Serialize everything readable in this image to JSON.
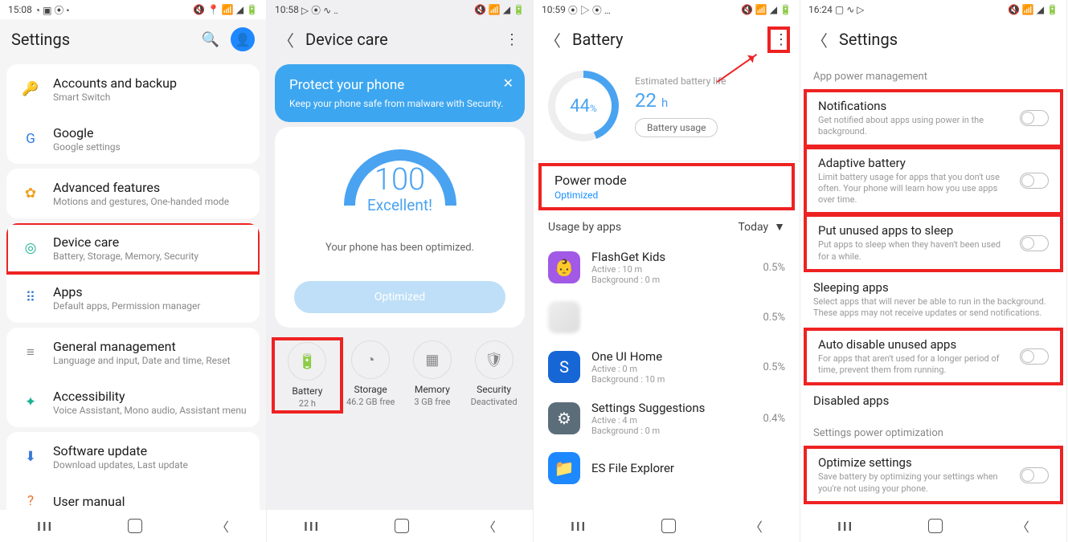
{
  "phone1": {
    "statusbar_time": "15:08",
    "header": "Settings",
    "groups": [
      [
        {
          "icon": "🔑",
          "icon_name": "key-icon",
          "color": "#2c7be5",
          "title": "Accounts and backup",
          "subtitle": "Smart Switch"
        },
        {
          "icon": "G",
          "icon_name": "google-icon",
          "color": "#2c7be5",
          "title": "Google",
          "subtitle": "Google settings"
        }
      ],
      [
        {
          "icon": "✿",
          "icon_name": "gear-flower-icon",
          "color": "#f0a020",
          "title": "Advanced features",
          "subtitle": "Motions and gestures, One-handed mode"
        }
      ],
      [
        {
          "icon": "◎",
          "icon_name": "device-care-icon",
          "color": "#1ab394",
          "title": "Device care",
          "subtitle": "Battery, Storage, Memory, Security",
          "highlight": true
        },
        {
          "icon": "⠿",
          "icon_name": "apps-grid-icon",
          "color": "#3a7bd5",
          "title": "Apps",
          "subtitle": "Default apps, Permission manager"
        }
      ],
      [
        {
          "icon": "≡",
          "icon_name": "sliders-icon",
          "color": "#888",
          "title": "General management",
          "subtitle": "Language and input, Date and time, Reset"
        },
        {
          "icon": "✦",
          "icon_name": "accessibility-icon",
          "color": "#1ab394",
          "title": "Accessibility",
          "subtitle": "Voice Assistant, Mono audio, Assistant menu"
        }
      ],
      [
        {
          "icon": "⬇",
          "icon_name": "download-icon",
          "color": "#3a7bd5",
          "title": "Software update",
          "subtitle": "Download updates, Last update"
        },
        {
          "icon": "?",
          "icon_name": "help-icon",
          "color": "#f07030",
          "title": "User manual",
          "subtitle": ""
        }
      ]
    ]
  },
  "phone2": {
    "statusbar_time": "10:58",
    "header": "Device care",
    "banner_title": "Protect your phone",
    "banner_sub": "Keep your phone safe from malware with Security.",
    "score": "100",
    "score_label": "Excellent!",
    "message": "Your phone has been optimized.",
    "button": "Optimized",
    "cols": [
      {
        "icon": "🔋",
        "name": "battery-icon",
        "label": "Battery",
        "val": "22 h",
        "highlight": true
      },
      {
        "icon": "◔",
        "name": "storage-icon",
        "label": "Storage",
        "val": "46.2 GB free"
      },
      {
        "icon": "▦",
        "name": "memory-icon",
        "label": "Memory",
        "val": "3 GB free"
      },
      {
        "icon": "🛡",
        "name": "security-icon",
        "label": "Security",
        "val": "Deactivated"
      }
    ]
  },
  "phone3": {
    "statusbar_time": "10:59",
    "header": "Battery",
    "percent": "44",
    "percent_unit": "%",
    "est_label": "Estimated battery life",
    "est_value": "22",
    "est_unit": "h",
    "battery_usage_btn": "Battery usage",
    "power_mode_title": "Power mode",
    "power_mode_value": "Optimized",
    "usage_by_apps": "Usage by apps",
    "today": "Today",
    "apps": [
      {
        "icon": "👶",
        "bg": "#a259e6",
        "title": "FlashGet Kids",
        "sub1": "Active : 10 m",
        "sub2": "Background : 0 m",
        "pct": "0.5%"
      },
      {
        "icon": "",
        "bg": "blur",
        "title": "",
        "sub1": "",
        "sub2": "",
        "pct": "0.5%"
      },
      {
        "icon": "S",
        "bg": "#1766d6",
        "title": "One UI Home",
        "sub1": "Active : 0 m",
        "sub2": "Background : 10 m",
        "pct": "0.5%"
      },
      {
        "icon": "⚙",
        "bg": "#5c6d7a",
        "title": "Settings Suggestions",
        "sub1": "Active : 4 m",
        "sub2": "Background : 0 m",
        "pct": "0.4%"
      },
      {
        "icon": "📁",
        "bg": "#1e88ff",
        "title": "ES File Explorer",
        "sub1": "",
        "sub2": "",
        "pct": ""
      }
    ]
  },
  "phone4": {
    "statusbar_time": "16:24",
    "header": "Settings",
    "section1": "App power management",
    "items1": [
      {
        "title": "Notifications",
        "sub": "Get notified about apps using power in the background.",
        "highlight": true
      },
      {
        "title": "Adaptive battery",
        "sub": "Limit battery usage for apps that you don't use often. Your phone will learn how you use apps over time.",
        "highlight": true
      },
      {
        "title": "Put unused apps to sleep",
        "sub": "Put apps to sleep when they haven't been used for a while.",
        "highlight": true
      }
    ],
    "items1b": [
      {
        "title": "Sleeping apps",
        "sub": "Select apps that will never be able to run in the background. These apps may not receive updates or send notifications.",
        "highlight": false,
        "notoggle": true
      },
      {
        "title": "Auto disable unused apps",
        "sub": "For apps that aren't used for a longer period of time, prevent them from running.",
        "highlight": true
      },
      {
        "title": "Disabled apps",
        "sub": "",
        "highlight": false,
        "notoggle": true
      }
    ],
    "section2": "Settings power optimization",
    "items2": [
      {
        "title": "Optimize settings",
        "sub": "Save battery by optimizing your settings when you're not using your phone.",
        "highlight": true
      }
    ]
  }
}
